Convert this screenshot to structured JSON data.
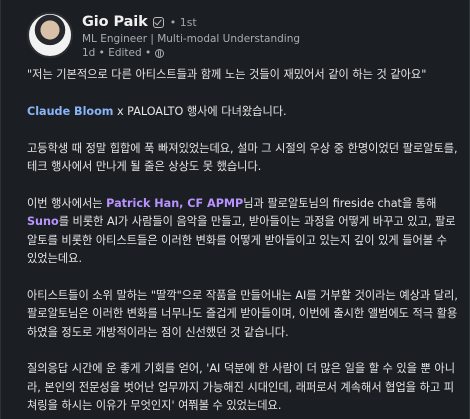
{
  "author": {
    "name": "Gio Paik",
    "degree": "• 1st",
    "headline": "ML Engineer | Multi-modal Understanding",
    "timestamp": "1d • Edited •"
  },
  "post": {
    "quote": "\"저는 기본적으로 다른 아티스트들과 함께 노는 것들이 재밌어서 같이 하는 것 같아요\"",
    "event_mention": "Claude Bloom",
    "event_rest": " x PALOALTO 행사에 다녀왔습니다.",
    "para2": "고등학생 때 정말 힙합에 푹 빠져있었는데요, 설마 그 시절의 우상 중 한명이었던 팔로알토를, 테크 행사에서 만나게 될 줄은 상상도 못 했습니다.",
    "para3_a": "이번 행사에서는 ",
    "para3_mention": "Patrick Han, CF APMP",
    "para3_b": "님과 팔로알토님의 fireside chat을 통해 ",
    "para3_mention2": "Suno",
    "para3_c": "를 비롯한 AI가 사람들이 음악을 만들고, 받아들이는 과정을 어떻게 바꾸고 있고, 팔로알토를 비롯한 아티스트들은 이러한 변화를 어떻게 받아들이고 있는지 깊이 있게 들어볼 수 있었는데요.",
    "para4": "아티스트들이 소위 말하는 \"딸깍\"으로 작품을 만들어내는 AI를 거부할 것이라는 예상과 달리, 팔로알토님은 이러한 변화를 너무나도 즐겁게 받아들이며, 이번에 출시한 앨범에도 적극 활용하였을 정도로 개방적이라는 점이 신선했던 것 같습니다.",
    "para5": "질의응답 시간에 운 좋게 기회를 얻어, 'AI 덕분에 한 사람이 더 많은 일을 할 수 있을 뿐 아니라, 본인의 전문성을 벗어난 업무까지 가능해진 시대인데, 래퍼로서 계속해서 협업을 하고 피쳐링을 하시는 이유가 무엇인지' 여쭤볼 수 있었는데요."
  },
  "colors": {
    "background": "#1b1f23",
    "mention_blue": "#8ab4f8",
    "mention_purple": "#b892ff"
  }
}
